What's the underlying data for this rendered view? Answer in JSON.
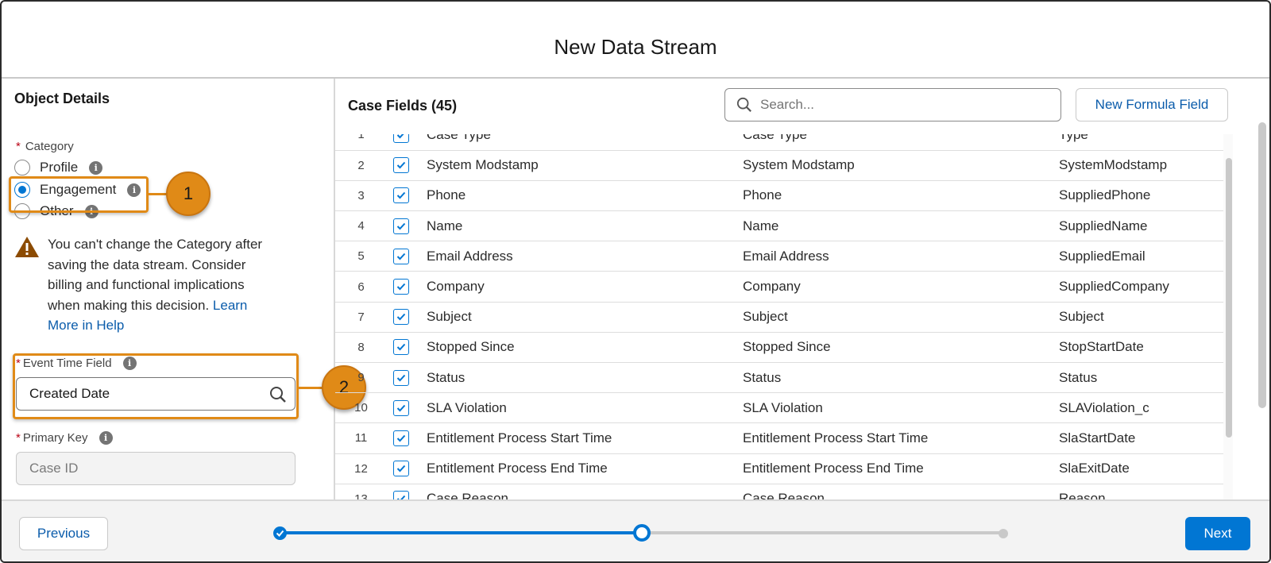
{
  "modal": {
    "title": "New Data Stream"
  },
  "left": {
    "section_title": "Object Details",
    "required_mark": "*",
    "category_label": "Category",
    "category_options": [
      {
        "label": "Profile",
        "selected": false
      },
      {
        "label": "Engagement",
        "selected": true
      },
      {
        "label": "Other",
        "selected": false
      }
    ],
    "warning_text": "You can't change the Category after saving the data stream. Consider billing and functional implications when making this decision.",
    "warning_link": "Learn More in Help",
    "event_time_label": "Event Time Field",
    "event_time_value": "Created Date",
    "primary_key_label": "Primary Key",
    "primary_key_value": "Case ID"
  },
  "callouts": {
    "one": "1",
    "two": "2"
  },
  "fields": {
    "title": "Case Fields (45)",
    "search_placeholder": "Search...",
    "new_formula_button": "New Formula Field",
    "rows": [
      {
        "num": "1",
        "label": "Case Type",
        "name": "Case Type",
        "api": "Type"
      },
      {
        "num": "2",
        "label": "System Modstamp",
        "name": "System Modstamp",
        "api": "SystemModstamp"
      },
      {
        "num": "3",
        "label": "Phone",
        "name": "Phone",
        "api": "SuppliedPhone"
      },
      {
        "num": "4",
        "label": "Name",
        "name": "Name",
        "api": "SuppliedName"
      },
      {
        "num": "5",
        "label": "Email Address",
        "name": "Email Address",
        "api": "SuppliedEmail"
      },
      {
        "num": "6",
        "label": "Company",
        "name": "Company",
        "api": "SuppliedCompany"
      },
      {
        "num": "7",
        "label": "Subject",
        "name": "Subject",
        "api": "Subject"
      },
      {
        "num": "8",
        "label": "Stopped Since",
        "name": "Stopped Since",
        "api": "StopStartDate"
      },
      {
        "num": "9",
        "label": "Status",
        "name": "Status",
        "api": "Status"
      },
      {
        "num": "10",
        "label": "SLA Violation",
        "name": "SLA Violation",
        "api": "SLAViolation_c"
      },
      {
        "num": "11",
        "label": "Entitlement Process Start Time",
        "name": "Entitlement Process Start Time",
        "api": "SlaStartDate"
      },
      {
        "num": "12",
        "label": "Entitlement Process End Time",
        "name": "Entitlement Process End Time",
        "api": "SlaExitDate"
      },
      {
        "num": "13",
        "label": "Case Reason",
        "name": "Case Reason",
        "api": "Reason"
      }
    ]
  },
  "footer": {
    "previous": "Previous",
    "next": "Next",
    "progress_fraction": 0.5,
    "current_step": 2,
    "total_steps": 3
  },
  "colors": {
    "brand": "#0176d3",
    "callout": "#e08a17",
    "link": "#0b5cab"
  }
}
